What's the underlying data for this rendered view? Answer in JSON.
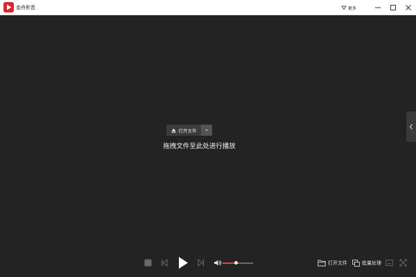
{
  "titlebar": {
    "app_title": "金舟影音",
    "more_label": "更多",
    "logo_icon": "play-logo-icon",
    "brand_color": "#d7262e"
  },
  "center": {
    "open_file_label": "打开文件",
    "drop_hint": "拖拽文件至此处进行播放"
  },
  "controls": {
    "volume_level": 0.45,
    "volume_color": "#e04848",
    "open_file_label": "打开文件",
    "batch_label": "批量处理"
  },
  "icons": {
    "more": "triangle-down-icon",
    "minimize": "minimize-icon",
    "maximize": "maximize-icon",
    "close": "close-icon",
    "side_tab": "chevron-left-icon",
    "eject": "eject-icon",
    "stop": "stop-icon",
    "previous": "skip-previous-icon",
    "play": "play-icon",
    "next": "skip-next-icon",
    "volume": "volume-icon",
    "folder": "folder-icon",
    "batch": "batch-icon",
    "subtitle": "subtitle-icon",
    "fullscreen": "fullscreen-icon"
  }
}
